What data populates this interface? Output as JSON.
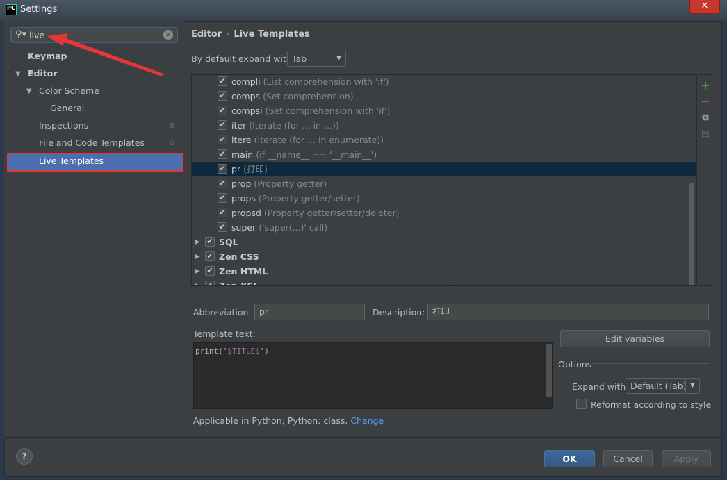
{
  "window": {
    "title": "Settings",
    "app_icon": "PC"
  },
  "search": {
    "value": "live"
  },
  "sidebar": {
    "items": [
      {
        "label": "Keymap"
      },
      {
        "label": "Editor"
      },
      {
        "label": "Color Scheme"
      },
      {
        "label": "General"
      },
      {
        "label": "Inspections"
      },
      {
        "label": "File and Code Templates"
      },
      {
        "label": "Live Templates"
      }
    ]
  },
  "breadcrumb": {
    "parent": "Editor",
    "separator": "›",
    "current": "Live Templates"
  },
  "expand_default": {
    "label": "By default expand with",
    "value": "Tab"
  },
  "templates": [
    {
      "name": "compli",
      "desc": "(List comprehension with 'if')",
      "checked": true
    },
    {
      "name": "comps",
      "desc": "(Set comprehension)",
      "checked": true
    },
    {
      "name": "compsi",
      "desc": "(Set comprehension with 'if')",
      "checked": true
    },
    {
      "name": "iter",
      "desc": "(Iterate (for ... in ...))",
      "checked": true
    },
    {
      "name": "itere",
      "desc": "(Iterate (for ... in enumerate))",
      "checked": true
    },
    {
      "name": "main",
      "desc": "(if __name__ == '__main__')",
      "checked": true
    },
    {
      "name": "pr",
      "desc": "(打印)",
      "checked": true,
      "selected": true
    },
    {
      "name": "prop",
      "desc": "(Property getter)",
      "checked": true
    },
    {
      "name": "props",
      "desc": "(Property getter/setter)",
      "checked": true
    },
    {
      "name": "propsd",
      "desc": "(Property getter/setter/deleter)",
      "checked": true
    },
    {
      "name": "super",
      "desc": "('super(...)' call)",
      "checked": true
    }
  ],
  "groups": [
    {
      "name": "SQL"
    },
    {
      "name": "Zen CSS"
    },
    {
      "name": "Zen HTML"
    },
    {
      "name": "Zen XSL"
    }
  ],
  "editor": {
    "abbreviation_label": "Abbreviation:",
    "abbreviation": "pr",
    "description_label": "Description:",
    "description": "打印",
    "template_label": "Template text:",
    "template_pre": "print('",
    "template_var": "$TITLE$",
    "template_post": "')",
    "edit_variables": "Edit variables",
    "options_label": "Options",
    "expand_with_label": "Expand with",
    "expand_with": "Default (Tab)",
    "reformat_label": "Reformat according to style",
    "applicable": "Applicable in Python; Python: class.",
    "change": "Change"
  },
  "footer": {
    "ok": "OK",
    "cancel": "Cancel",
    "apply": "Apply",
    "help": "?"
  },
  "colors": {
    "accent": "#4b6eaf",
    "selection": "#0d293e",
    "annotation": "#e5363a",
    "link": "#589df6"
  }
}
